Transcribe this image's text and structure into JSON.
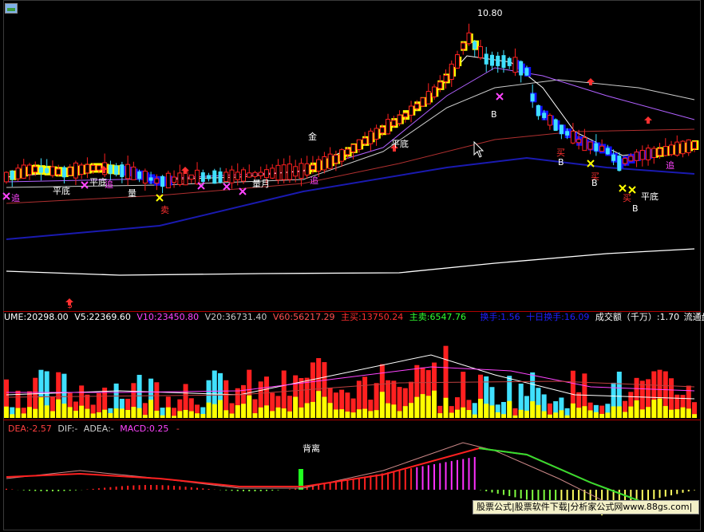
{
  "price_panel": {
    "high_label": "10.80",
    "labels": {
      "pingdi": "平底",
      "zhui": "追",
      "mai": "买",
      "mai_sell": "卖",
      "jin": "金",
      "liang": "量",
      "liang_yue": "量月",
      "b": "B",
      "dollar": "$"
    }
  },
  "volume_panel": {
    "header": [
      {
        "text": "UME:20298.00",
        "color": "#ffffff"
      },
      {
        "text": "V5:22369.60",
        "color": "#ffffff"
      },
      {
        "text": "V10:23450.80",
        "color": "#ff44ff"
      },
      {
        "text": "V20:36731.40",
        "color": "#c8c8c8"
      },
      {
        "text": "V60:56217.29",
        "color": "#ff5050"
      },
      {
        "text": "主买:13750.24",
        "color": "#ff3030"
      },
      {
        "text": "主卖:6547.76",
        "color": "#30ff30"
      },
      {
        "text": "换手:1.56",
        "color": "#2020ff"
      },
      {
        "text": "十日换手:16.09",
        "color": "#2020ff"
      },
      {
        "text": "成交额（千万）:1.70",
        "color": "#ffffff"
      },
      {
        "text": "流通盘",
        "color": "#ffffff"
      }
    ]
  },
  "macd_panel": {
    "header": [
      {
        "text": "DEA:-2.57",
        "color": "#ff4040"
      },
      {
        "text": "DIF:-",
        "color": "#d0d0d0"
      },
      {
        "text": "ADEA:-",
        "color": "#d0d0d0"
      },
      {
        "text": "MACD:0.25",
        "color": "#ff44ff"
      },
      {
        "text": "-",
        "color": "#ff4040"
      }
    ],
    "divergence_label": "背离"
  },
  "watermark": {
    "text": "股票公式|股票软件下载|分析家公式网www.88gs.com|"
  },
  "colors": {
    "up": "#ff2020",
    "down": "#40e0ff",
    "ribbon_up": "#ffff00",
    "ribbon_down": "#1010ff",
    "ma_long": "#1a1ab0"
  }
}
